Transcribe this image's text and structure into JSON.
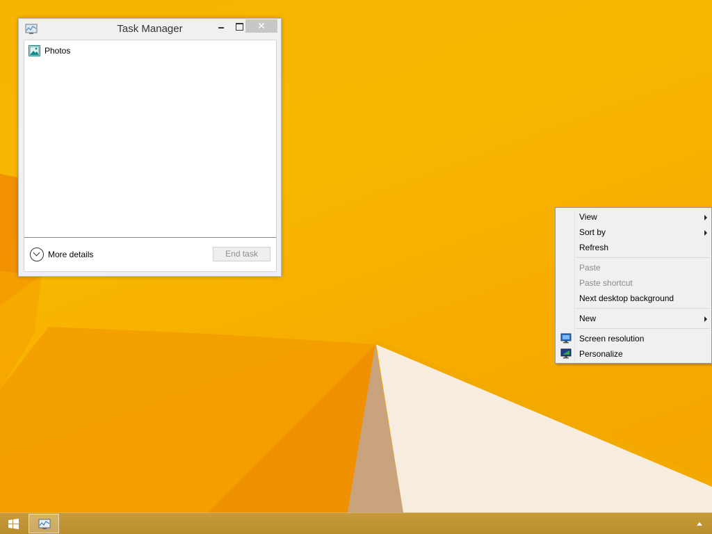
{
  "task_manager": {
    "title": "Task Manager",
    "apps": [
      {
        "name": "Photos",
        "icon": "photos-icon"
      }
    ],
    "more_details_label": "More details",
    "end_task_label": "End task",
    "close_glyph": "✕"
  },
  "context_menu": {
    "items": [
      {
        "label": "View",
        "submenu": true,
        "disabled": false
      },
      {
        "label": "Sort by",
        "submenu": true,
        "disabled": false
      },
      {
        "label": "Refresh",
        "submenu": false,
        "disabled": false
      },
      {
        "label": "Paste",
        "submenu": false,
        "disabled": true
      },
      {
        "label": "Paste shortcut",
        "submenu": false,
        "disabled": true
      },
      {
        "label": "Next desktop background",
        "submenu": false,
        "disabled": false
      },
      {
        "label": "New",
        "submenu": true,
        "disabled": false
      },
      {
        "label": "Screen resolution",
        "submenu": false,
        "disabled": false,
        "icon": "screen-resolution-icon"
      },
      {
        "label": "Personalize",
        "submenu": false,
        "disabled": false,
        "icon": "personalize-icon"
      }
    ]
  },
  "taskbar": {
    "start_icon": "windows-logo-icon",
    "pinned": [
      {
        "name": "Task Manager",
        "icon": "task-manager-icon"
      }
    ],
    "tray_icon": "show-hidden-icons-icon"
  },
  "colors": {
    "wallpaper": "#f9b800",
    "taskbar": "#c79b3b"
  }
}
